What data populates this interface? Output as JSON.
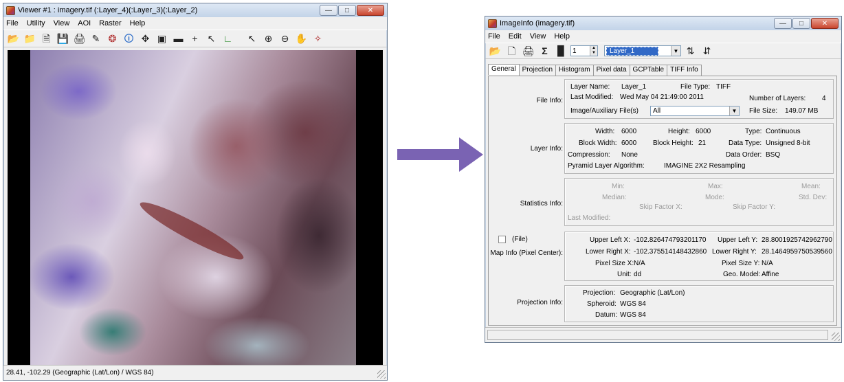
{
  "viewer": {
    "title": "Viewer #1 : imagery.tif (:Layer_4)(:Layer_3)(:Layer_2)",
    "menu": [
      "File",
      "Utility",
      "View",
      "AOI",
      "Raster",
      "Help"
    ],
    "status": "28.41, -102.29  (Geographic (Lat/Lon) / WGS 84)"
  },
  "imageinfo": {
    "title": "ImageInfo (imagery.tif)",
    "menu": [
      "File",
      "Edit",
      "View",
      "Help"
    ],
    "layer_number": "1",
    "layer_select": "Layer_1",
    "tabs": [
      "General",
      "Projection",
      "Histogram",
      "Pixel data",
      "GCPTable",
      "TIFF Info"
    ],
    "file_info": {
      "label": "File Info:",
      "layer_name_label": "Layer Name:",
      "layer_name": "Layer_1",
      "file_type_label": "File Type:",
      "file_type": "TIFF",
      "last_modified_label": "Last Modified:",
      "last_modified": "Wed May 04 21:49:00 2011",
      "num_layers_label": "Number of Layers:",
      "num_layers": "4",
      "aux_label": "Image/Auxiliary File(s)",
      "aux_value": "All",
      "file_size_label": "File Size:",
      "file_size": "149.07 MB"
    },
    "layer_info": {
      "label": "Layer Info:",
      "width_label": "Width:",
      "width": "6000",
      "height_label": "Height:",
      "height": "6000",
      "type_label": "Type:",
      "type": "Continuous",
      "block_width_label": "Block Width:",
      "block_width": "6000",
      "block_height_label": "Block Height:",
      "block_height": "21",
      "data_type_label": "Data Type:",
      "data_type": "Unsigned 8-bit",
      "compression_label": "Compression:",
      "compression": "None",
      "data_order_label": "Data Order:",
      "data_order": "BSQ",
      "pyramid_label": "Pyramid Layer Algorithm:",
      "pyramid": "IMAGINE 2X2 Resampling"
    },
    "stats_info": {
      "label": "Statistics Info:",
      "min": "Min:",
      "max": "Max:",
      "mean": "Mean:",
      "median": "Median:",
      "mode": "Mode:",
      "std_dev": "Std. Dev:",
      "skip_x": "Skip Factor X:",
      "skip_y": "Skip Factor Y:",
      "last_modified": "Last Modified:"
    },
    "map_info": {
      "file_check": "(File)",
      "label": "Map Info (Pixel Center):",
      "ulx_label": "Upper Left X:",
      "ulx": "-102.826474793201170",
      "uly_label": "Upper Left Y:",
      "uly": "28.8001925742962790",
      "lrx_label": "Lower Right X:",
      "lrx": "-102.375514148432860",
      "lry_label": "Lower Right Y:",
      "lry": "28.1464959750539560",
      "psx_label": "Pixel Size X:",
      "psx": "N/A",
      "psy_label": "Pixel Size Y:",
      "psy": "N/A",
      "unit_label": "Unit:",
      "unit": "dd",
      "geo_label": "Geo. Model:",
      "geo": "Affine"
    },
    "proj_info": {
      "label": "Projection Info:",
      "projection_label": "Projection:",
      "projection": "Geographic (Lat/Lon)",
      "spheroid_label": "Spheroid:",
      "spheroid": "WGS 84",
      "datum_label": "Datum:",
      "datum": "WGS 84"
    }
  },
  "colors": {
    "arrow": "#7a63b3",
    "selection": "#3169c6"
  }
}
